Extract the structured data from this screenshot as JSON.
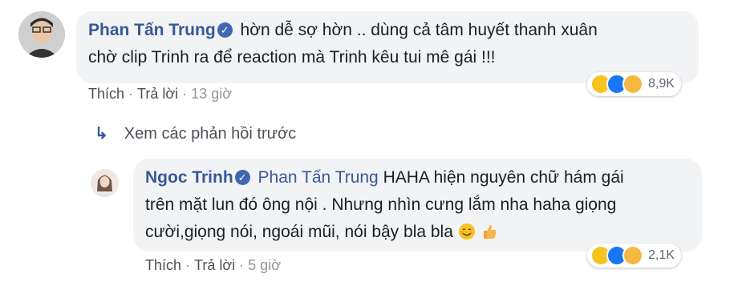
{
  "comment1": {
    "author": "Phan Tấn Trung",
    "text_line1": "hờn dễ sợ hờn .. dùng cả tâm huyết thanh xuân",
    "text_line2": "chờ clip Trinh ra để reaction mà Trinh kêu tui mê gái !!!",
    "like_label": "Thích",
    "reply_label": "Trả lời",
    "time": "13 giờ",
    "reaction_count": "8,9K"
  },
  "view_previous_replies": "Xem các phản hồi trước",
  "reply1": {
    "author": "Ngoc Trinh",
    "tagged_user": "Phan Tấn Trung",
    "text_line1": "HAHA hiện nguyên chữ hám gái",
    "text_line2": "trên mặt lun đó ông nội . Nhưng nhìn cưng lắm nha haha giọng",
    "text_line3": "cười,giọng nói, ngoái mũi, nói bậy bla bla",
    "like_label": "Thích",
    "reply_label": "Trả lời",
    "time": "5 giờ",
    "reaction_count": "2,1K"
  },
  "icons": {
    "verified": "verified-badge-icon",
    "reply_arrow": "reply-arrow-icon",
    "reactions": [
      "haha-icon",
      "like-icon",
      "sad-icon"
    ],
    "inline_emoji": [
      "smiling-face-icon",
      "thumbs-up-icon"
    ]
  },
  "colors": {
    "name": "#385898",
    "bubble": "#f2f3f5",
    "muted": "#90949c",
    "like_blue": "#1877f2",
    "haha_yellow": "#f7c41f"
  }
}
